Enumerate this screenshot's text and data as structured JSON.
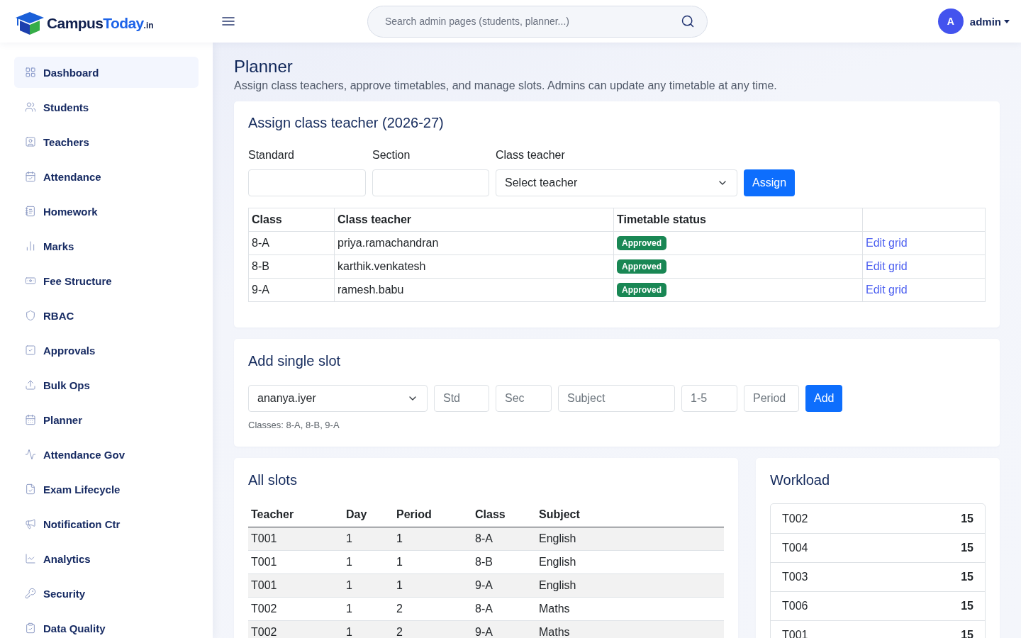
{
  "header": {
    "logo": {
      "primary": "Campus",
      "accent": "Today",
      "suffix": ".in"
    },
    "search": {
      "placeholder": "Search admin pages (students, planner...)"
    },
    "user": {
      "initial": "A",
      "name": "admin"
    }
  },
  "sidebar": {
    "items": [
      {
        "label": "Dashboard",
        "selected": true
      },
      {
        "label": "Students",
        "selected": false
      },
      {
        "label": "Teachers",
        "selected": false
      },
      {
        "label": "Attendance",
        "selected": false
      },
      {
        "label": "Homework",
        "selected": false
      },
      {
        "label": "Marks",
        "selected": false
      },
      {
        "label": "Fee Structure",
        "selected": false
      },
      {
        "label": "RBAC",
        "selected": false
      },
      {
        "label": "Approvals",
        "selected": false
      },
      {
        "label": "Bulk Ops",
        "selected": false
      },
      {
        "label": "Planner",
        "selected": false
      },
      {
        "label": "Attendance Gov",
        "selected": false
      },
      {
        "label": "Exam Lifecycle",
        "selected": false
      },
      {
        "label": "Notification Ctr",
        "selected": false
      },
      {
        "label": "Analytics",
        "selected": false
      },
      {
        "label": "Security",
        "selected": false
      },
      {
        "label": "Data Quality",
        "selected": false
      }
    ]
  },
  "page": {
    "title": "Planner",
    "subtitle": "Assign class teachers, approve timetables, and manage slots. Admins can update any timetable at any time."
  },
  "assign_card": {
    "title": "Assign class teacher (2026-27)",
    "fields": [
      {
        "kind": "input",
        "label": "Standard"
      },
      {
        "kind": "input",
        "label": "Section"
      },
      {
        "kind": "select",
        "label": "Class teacher",
        "value": "Select teacher"
      }
    ],
    "button": "Assign",
    "table": {
      "columns": [
        "Class",
        "Class teacher",
        "Timetable status"
      ],
      "rows": [
        {
          "class": "8-A",
          "teacher": "priya.ramachandran",
          "status": "Approved",
          "action": "Edit grid"
        },
        {
          "class": "8-B",
          "teacher": "karthik.venkatesh",
          "status": "Approved",
          "action": "Edit grid"
        },
        {
          "class": "9-A",
          "teacher": "ramesh.babu",
          "status": "Approved",
          "action": "Edit grid"
        }
      ]
    }
  },
  "slot_card": {
    "title": "Add single slot",
    "controls": [
      {
        "kind": "select",
        "value": "ananya.iyer"
      },
      {
        "kind": "input",
        "placeholder": "Std"
      },
      {
        "kind": "input",
        "placeholder": "Sec"
      },
      {
        "kind": "input",
        "placeholder": "Subject"
      },
      {
        "kind": "input",
        "placeholder": "1-5"
      },
      {
        "kind": "input",
        "placeholder": "Period"
      }
    ],
    "button": "Add",
    "help": "Classes: 8-A, 8-B, 9-A"
  },
  "slots_card": {
    "title": "All slots",
    "table": {
      "columns": [
        "Teacher",
        "Day",
        "Period",
        "Class",
        "Subject"
      ],
      "rows": [
        [
          "T001",
          "1",
          "1",
          "8-A",
          "English"
        ],
        [
          "T001",
          "1",
          "1",
          "8-B",
          "English"
        ],
        [
          "T001",
          "1",
          "1",
          "9-A",
          "English"
        ],
        [
          "T002",
          "1",
          "2",
          "8-A",
          "Maths"
        ],
        [
          "T002",
          "1",
          "2",
          "9-A",
          "Maths"
        ]
      ]
    }
  },
  "workload_card": {
    "title": "Workload",
    "items": [
      {
        "label": "T002",
        "count": "15"
      },
      {
        "label": "T004",
        "count": "15"
      },
      {
        "label": "T003",
        "count": "15"
      },
      {
        "label": "T006",
        "count": "15"
      },
      {
        "label": "T001",
        "count": "15"
      }
    ]
  }
}
